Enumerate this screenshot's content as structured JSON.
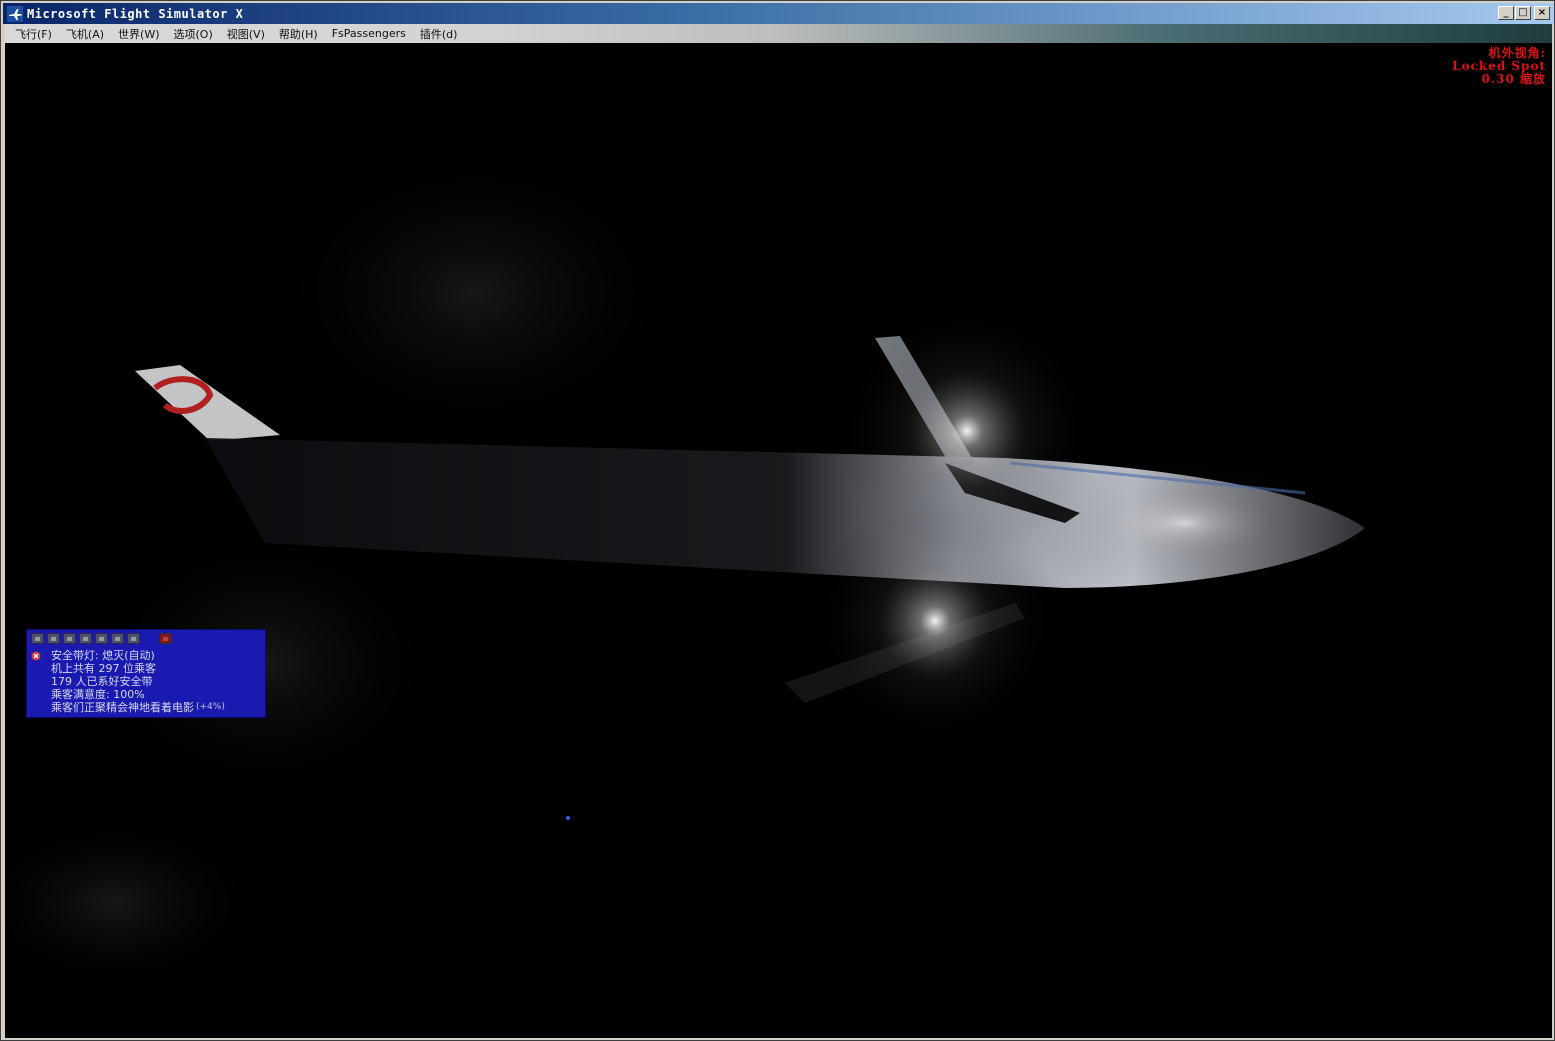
{
  "window": {
    "title": "Microsoft Flight Simulator X",
    "controls": {
      "minimize": "_",
      "maximize": "□",
      "close": "×"
    }
  },
  "menu": {
    "items": [
      {
        "label": "飞行(F)"
      },
      {
        "label": "飞机(A)"
      },
      {
        "label": "世界(W)"
      },
      {
        "label": "选项(O)"
      },
      {
        "label": "视图(V)"
      },
      {
        "label": "帮助(H)"
      },
      {
        "label": "FsPassengers"
      },
      {
        "label": "插件(d)"
      }
    ]
  },
  "view_info": {
    "line1": "机外视角:",
    "line2": "Locked Spot",
    "line3": "0.30 缩放"
  },
  "fspassengers": {
    "line1": "安全带灯: 熄灭(自动)",
    "line2": "机上共有 297 位乘客",
    "line3": "179 人已系好安全带",
    "line4": "乘客满意度: 100%",
    "line5": "乘客们正聚精会神地看着电影",
    "line5_suffix": "(+4%)"
  },
  "colors": {
    "overlay_text": "#e01010",
    "panel_bg": "#1a1ab0",
    "titlebar": "#0a246a"
  }
}
